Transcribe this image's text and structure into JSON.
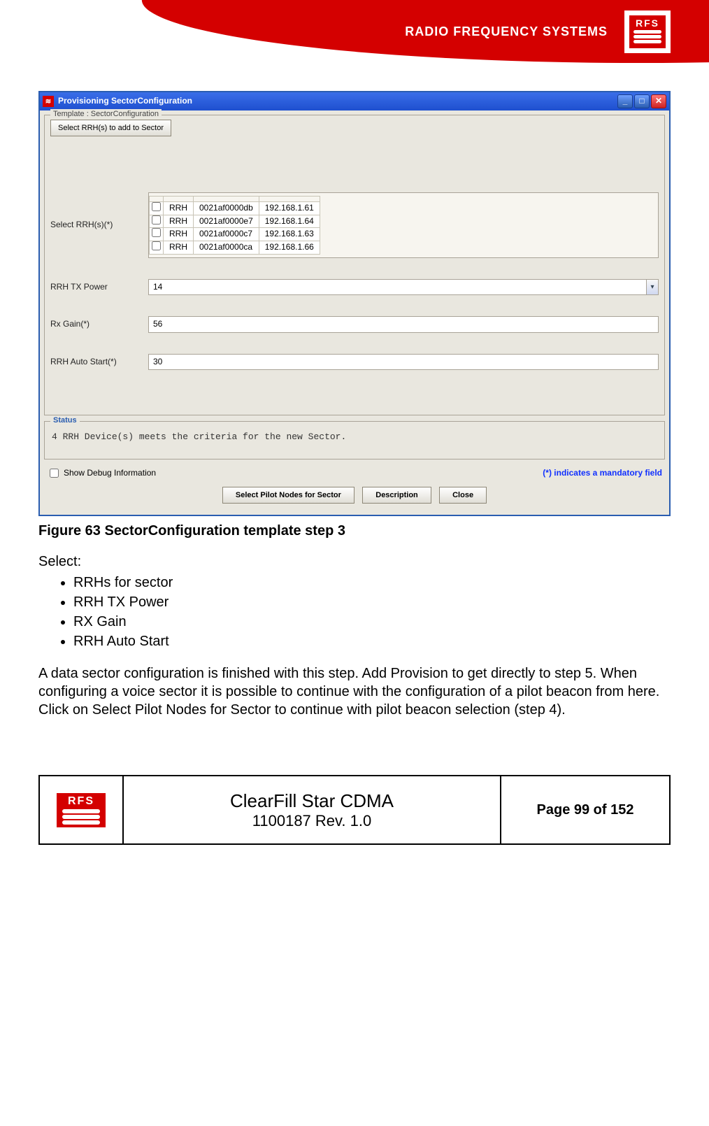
{
  "header": {
    "company_name": "RADIO FREQUENCY SYSTEMS",
    "logo_text": "RFS"
  },
  "dialog": {
    "title": "Provisioning SectorConfiguration",
    "template_legend": "Template : SectorConfiguration",
    "toolbar_button": "Select RRH(s) to add to Sector",
    "labels": {
      "select_rrhs": "Select RRH(s)(*)",
      "tx_power": "RRH TX Power",
      "rx_gain": "Rx Gain(*)",
      "auto_start": "RRH Auto Start(*)"
    },
    "values": {
      "tx_power": "14",
      "rx_gain": "56",
      "auto_start": "30"
    },
    "rrh_rows": [
      {
        "type": "RRH",
        "mac": "0021af0000db",
        "ip": "192.168.1.61"
      },
      {
        "type": "RRH",
        "mac": "0021af0000e7",
        "ip": "192.168.1.64"
      },
      {
        "type": "RRH",
        "mac": "0021af0000c7",
        "ip": "192.168.1.63"
      },
      {
        "type": "RRH",
        "mac": "0021af0000ca",
        "ip": "192.168.1.66"
      }
    ],
    "status_legend": "Status",
    "status_text": "4 RRH Device(s) meets the criteria for the new Sector.",
    "show_debug": "Show Debug Information",
    "mandatory_note": "(*) indicates a mandatory field",
    "buttons": {
      "select_pilot": "Select Pilot Nodes for Sector",
      "description": "Description",
      "close": "Close"
    }
  },
  "caption": "Figure 63 SectorConfiguration template step 3",
  "body": {
    "select_intro": "Select:",
    "bullets": [
      "RRHs for sector",
      "RRH TX Power",
      "RX Gain",
      "RRH Auto Start"
    ],
    "paragraph": "A data sector configuration is finished with this step. Add Provision to get directly to step 5. When configuring a voice sector it is possible to continue with the configuration of a pilot beacon from here. Click on Select Pilot Nodes for Sector to continue with pilot beacon selection (step 4)."
  },
  "footer": {
    "logo_text": "RFS",
    "product": "ClearFill Star CDMA",
    "docid": "1100187 Rev. 1.0",
    "page": "Page 99 of 152"
  }
}
